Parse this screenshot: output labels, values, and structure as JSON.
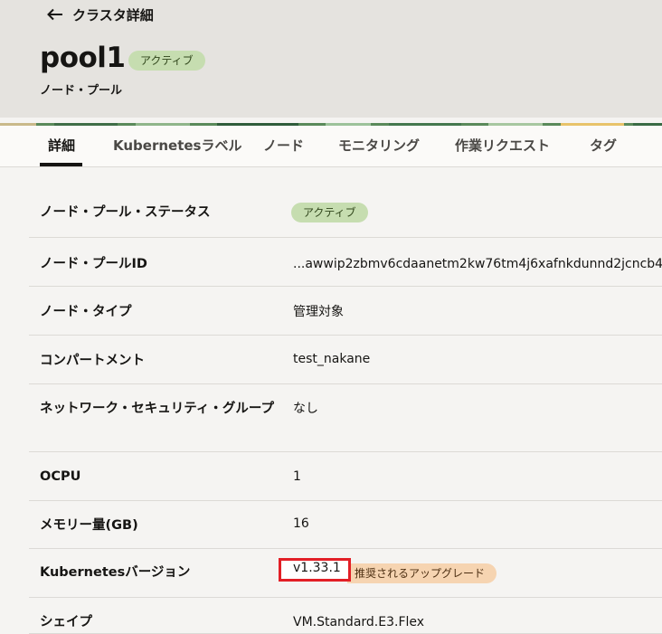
{
  "header": {
    "back_label": "クラスタ詳細",
    "title": "pool1",
    "status_badge": "アクティブ",
    "subtitle": "ノード・プール"
  },
  "tabs": [
    {
      "label": "詳細",
      "active": true
    },
    {
      "label": "Kubernetesラベル",
      "active": false
    },
    {
      "label": "ノード",
      "active": false
    },
    {
      "label": "モニタリング",
      "active": false
    },
    {
      "label": "作業リクエスト",
      "active": false
    },
    {
      "label": "タグ",
      "active": false
    }
  ],
  "details": {
    "status": {
      "label": "ノード・プール・ステータス",
      "value": "アクティブ"
    },
    "pool_id": {
      "label": "ノード・プールID",
      "value": "...awwip2zbmv6cdaanetm2kw76tm4j6xafnkdunnd2jcncb4"
    },
    "node_type": {
      "label": "ノード・タイプ",
      "value": "管理対象"
    },
    "compartment": {
      "label": "コンパートメント",
      "value": "test_nakane"
    },
    "nsg": {
      "label": "ネットワーク・セキュリティ・グループ",
      "value": "なし"
    },
    "ocpu": {
      "label": "OCPU",
      "value": "1"
    },
    "memory": {
      "label": "メモリー量(GB)",
      "value": "16"
    },
    "k8s_version": {
      "label": "Kubernetesバージョン",
      "value": "v1.33.1",
      "upgrade_badge": "推奨されるアップグレード"
    },
    "shape": {
      "label": "シェイプ",
      "value": "VM.Standard.E3.Flex"
    }
  },
  "colors": {
    "active_badge": "#c6ddb0",
    "upgrade_badge": "#f6d4b1",
    "highlight": "#e21f26"
  }
}
